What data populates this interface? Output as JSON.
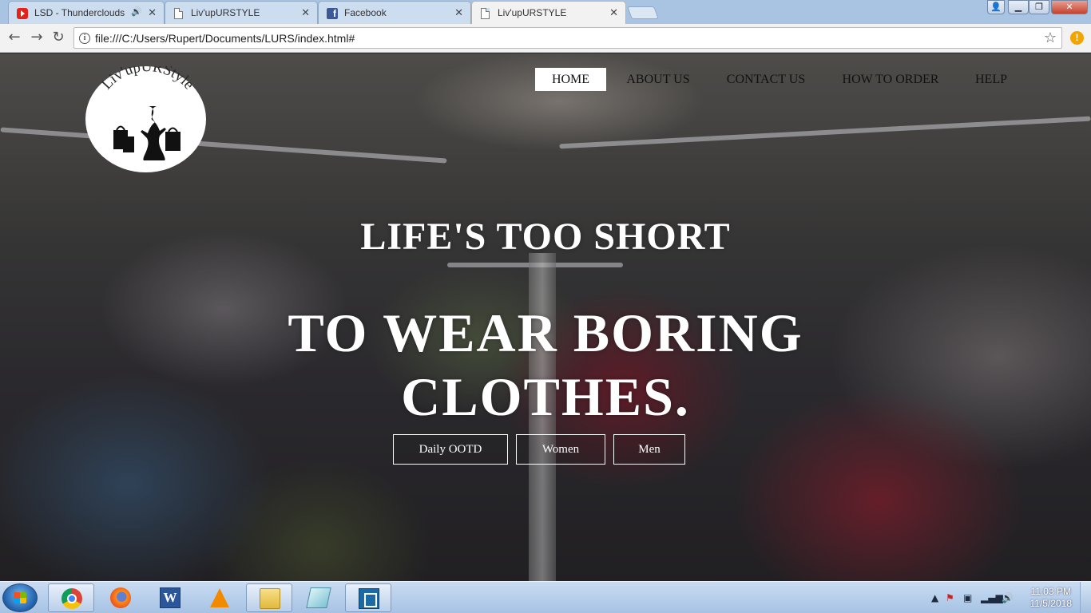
{
  "browser": {
    "tabs": [
      {
        "title": "LSD - Thunderclouds",
        "icon": "youtube-icon",
        "audio": true,
        "active": false
      },
      {
        "title": "Liv'upURSTYLE",
        "icon": "page-icon",
        "active": false
      },
      {
        "title": "Facebook",
        "icon": "facebook-icon",
        "active": false
      },
      {
        "title": "Liv'upURSTYLE",
        "icon": "page-icon",
        "active": true
      }
    ],
    "url": "file:///C:/Users/Rupert/Documents/LURS/index.html#",
    "close_glyph": "✕",
    "window_buttons": {
      "minimize": "▁",
      "maximize": "❐",
      "close": "✕"
    }
  },
  "site": {
    "logo_text": "Liv'upURStyle",
    "nav": [
      "HOME",
      "ABOUT US",
      "CONTACT US",
      "HOW TO ORDER",
      "HELP"
    ],
    "active_nav": "HOME",
    "headline_1": "LIFE'S TOO SHORT",
    "headline_2_line1": "TO WEAR BORING",
    "headline_2_line2": "CLOTHES.",
    "buttons": [
      "Daily OOTD",
      "Women",
      "Men"
    ]
  },
  "taskbar": {
    "apps": [
      "chrome",
      "firefox",
      "word",
      "vlc",
      "file-explorer",
      "notepad",
      "brackets"
    ],
    "clock_time": "11:03 PM",
    "clock_date": "11/5/2018"
  },
  "colors": {
    "accent_white": "#ffffff",
    "nav_active_bg": "#ffffff",
    "titlebar": "#a9c4e3"
  }
}
